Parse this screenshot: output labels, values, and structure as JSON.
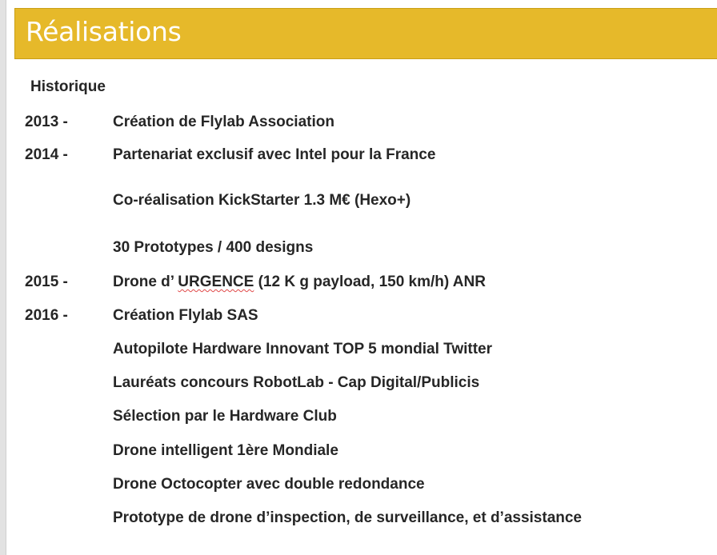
{
  "header": {
    "title": "Réalisations",
    "accent_color": "#e6b92a"
  },
  "section": {
    "subheading": "Historique"
  },
  "timeline": {
    "y2013": {
      "year": "2013 -",
      "items": [
        "Création de Flylab Association"
      ]
    },
    "y2014": {
      "year": "2014 -",
      "items": [
        "Partenariat exclusif avec Intel pour la France",
        "Co-réalisation KickStarter 1.3 M€ (Hexo+)",
        "30 Prototypes / 400 designs"
      ]
    },
    "y2015": {
      "year": "2015 -",
      "part1": "Drone d’ ",
      "part2": "URGENCE",
      "part3": " (12 K g payload, 150 km/h) ANR"
    },
    "y2016": {
      "year": "2016 -",
      "items": [
        "Création Flylab SAS",
        "Autopilote Hardware Innovant TOP 5 mondial Twitter",
        "Lauréats concours RobotLab - Cap Digital/Publicis",
        "Sélection par le Hardware Club",
        "Drone intelligent 1ère Mondiale",
        "Drone Octocopter avec double redondance",
        "Prototype de drone d’inspection, de surveillance, et d’assistance"
      ]
    }
  }
}
